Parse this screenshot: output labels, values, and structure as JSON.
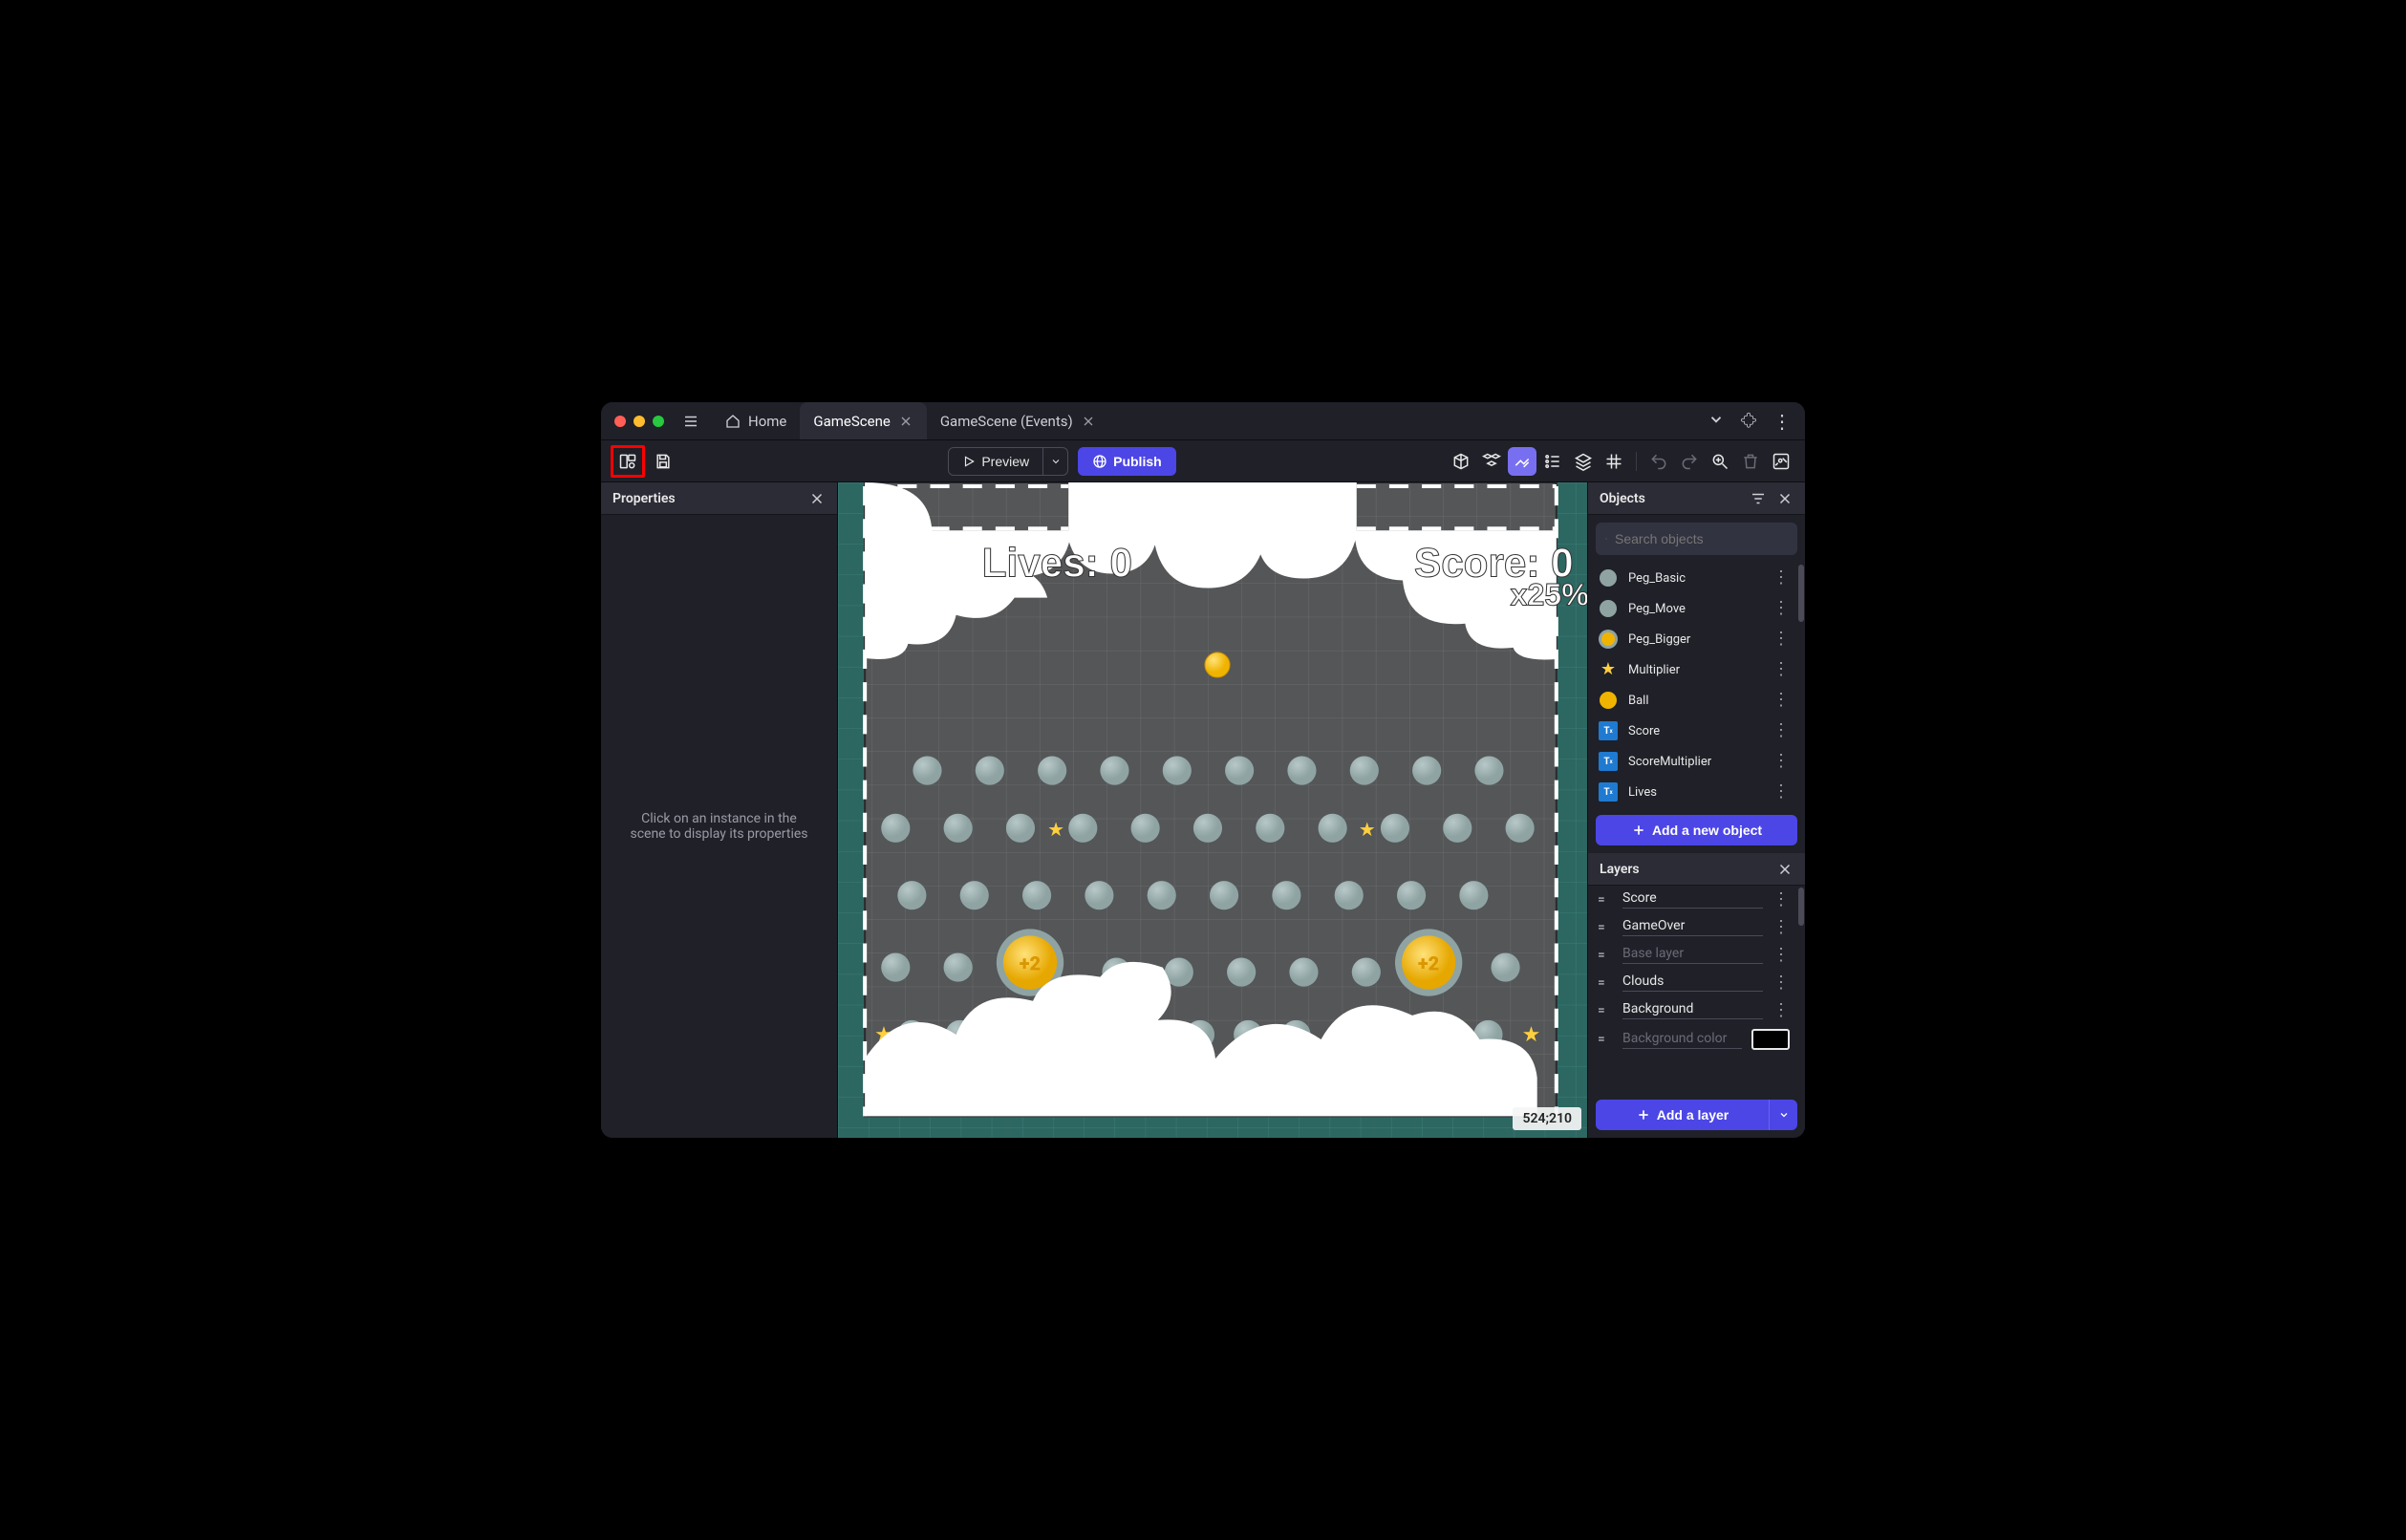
{
  "tabs": {
    "home": "Home",
    "scene": "GameScene",
    "events": "GameScene (Events)"
  },
  "toolbar": {
    "preview": "Preview",
    "publish": "Publish"
  },
  "properties": {
    "title": "Properties",
    "help": "Click on an instance in the scene to display its properties"
  },
  "objects": {
    "title": "Objects",
    "search_placeholder": "Search objects",
    "add": "Add a new object",
    "list": [
      {
        "name": "Peg_Basic",
        "kind": "peg-gray"
      },
      {
        "name": "Peg_Move",
        "kind": "peg-gray"
      },
      {
        "name": "Peg_Bigger",
        "kind": "coin"
      },
      {
        "name": "Multiplier",
        "kind": "star"
      },
      {
        "name": "Ball",
        "kind": "ball"
      },
      {
        "name": "Score",
        "kind": "txt"
      },
      {
        "name": "ScoreMultiplier",
        "kind": "txt"
      },
      {
        "name": "Lives",
        "kind": "txt"
      }
    ]
  },
  "layers": {
    "title": "Layers",
    "add": "Add a layer",
    "list": [
      {
        "name": "Score"
      },
      {
        "name": "GameOver"
      },
      {
        "name": "Base layer",
        "dim": true
      },
      {
        "name": "Clouds"
      },
      {
        "name": "Background"
      },
      {
        "name": "Background color",
        "dim": true,
        "swatch": "#000000"
      }
    ]
  },
  "hud": {
    "lives": "Lives: 0",
    "score": "Score: 0",
    "mult": "x25%"
  },
  "bonus_label": "+2",
  "coord": "524;210"
}
